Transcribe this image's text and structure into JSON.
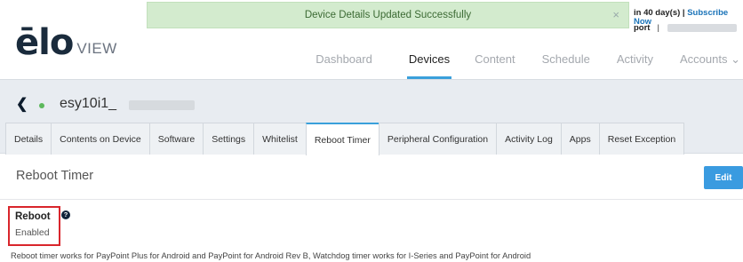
{
  "brand": {
    "logo_primary": "ēlo",
    "logo_secondary": "VIEW"
  },
  "toast": {
    "message": "Device Details Updated Successfully",
    "close_glyph": "×"
  },
  "account": {
    "trial_text": "in 40 day(s) |",
    "subscribe_label": "Subscribe Now",
    "support_label": "port",
    "separator": "|"
  },
  "nav": {
    "items": [
      {
        "label": "Dashboard",
        "active": false
      },
      {
        "label": "Devices",
        "active": true
      },
      {
        "label": "Content",
        "active": false
      },
      {
        "label": "Schedule",
        "active": false
      },
      {
        "label": "Activity",
        "active": false
      },
      {
        "label": "Accounts ⌄",
        "active": false
      }
    ]
  },
  "device": {
    "back_icon": "chevron-left-icon",
    "back_glyph": "❮",
    "status": "online",
    "status_color": "#5cb85c",
    "name_prefix": "esy10i1_"
  },
  "tabs": [
    {
      "label": "Details",
      "active": false
    },
    {
      "label": "Contents on Device",
      "active": false
    },
    {
      "label": "Software",
      "active": false
    },
    {
      "label": "Settings",
      "active": false
    },
    {
      "label": "Whitelist",
      "active": false
    },
    {
      "label": "Reboot Timer",
      "active": true
    },
    {
      "label": "Peripheral Configuration",
      "active": false
    },
    {
      "label": "Activity Log",
      "active": false
    },
    {
      "label": "Apps",
      "active": false
    },
    {
      "label": "Reset Exception",
      "active": false
    }
  ],
  "content": {
    "section_title": "Reboot Timer",
    "edit_label": "Edit",
    "reboot_label": "Reboot",
    "help_glyph": "?",
    "reboot_value": "Enabled",
    "note": "Reboot timer works for PayPoint Plus for Android and PayPoint for Android Rev B, Watchdog timer works for I-Series and PayPoint for Android"
  },
  "colors": {
    "accent": "#3aa0db",
    "toast_bg": "#d3ebce",
    "highlight": "#d9262c",
    "band_bg": "#e8ecf1"
  }
}
